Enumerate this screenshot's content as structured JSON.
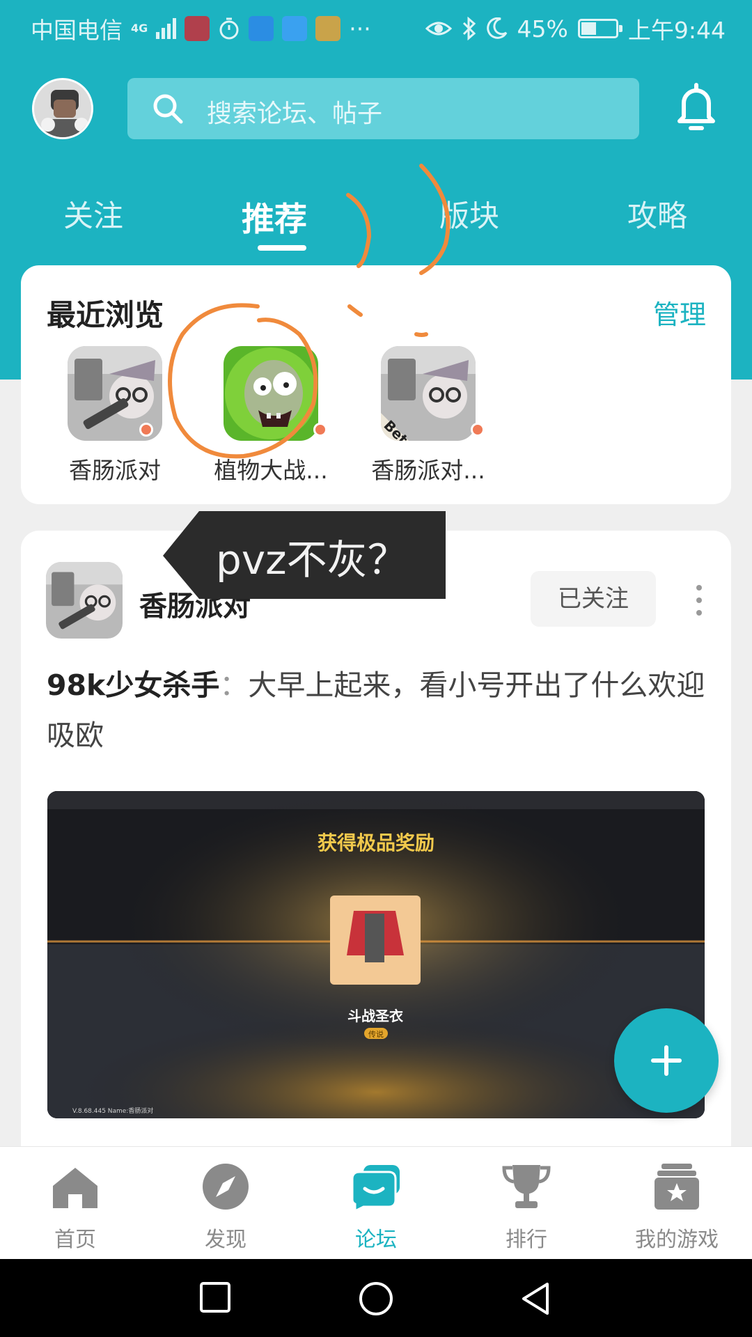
{
  "status_bar": {
    "carrier": "中国电信",
    "network": "4G",
    "battery_percent": "45%",
    "battery_level": 0.45,
    "time": "上午9:44",
    "more": "···",
    "colors": {
      "mic_app": "#b0404c",
      "bird_app": "#2b8de3",
      "baidu_app": "#3aa1f0",
      "play_app": "#c9a34a"
    }
  },
  "header": {
    "search_placeholder": "搜索论坛、帖子",
    "tabs": [
      {
        "label": "关注"
      },
      {
        "label": "推荐"
      },
      {
        "label": "版块"
      },
      {
        "label": "攻略"
      }
    ],
    "active_tab": "推荐"
  },
  "recent": {
    "title": "最近浏览",
    "manage": "管理",
    "games": [
      {
        "name": "香肠派对",
        "icon": "sausage-party-icon"
      },
      {
        "name": "植物大战...",
        "icon": "plants-vs-zombies-icon"
      },
      {
        "name": "香肠派对...",
        "icon": "sausage-party-beta-icon",
        "badge": "Beta"
      }
    ]
  },
  "annotation": {
    "tooltip": "pvz不灰？",
    "color": "#f08a3c"
  },
  "post": {
    "game_name": "香肠派对",
    "follow_label": "已关注",
    "author": "98k少女杀手",
    "separator": "：",
    "content": "大早上起来，看小号开出了什么欢迎吸欧",
    "image": {
      "title": "获得极品奖励",
      "item_name": "斗战圣衣",
      "rarity": "传说",
      "version": "V.8.68.445 Name:香肠派对"
    }
  },
  "bottom_nav": [
    {
      "label": "首页",
      "icon": "home-icon"
    },
    {
      "label": "发现",
      "icon": "compass-icon"
    },
    {
      "label": "论坛",
      "icon": "forum-icon"
    },
    {
      "label": "排行",
      "icon": "trophy-icon"
    },
    {
      "label": "我的游戏",
      "icon": "my-games-icon"
    }
  ],
  "active_nav": "论坛",
  "colors": {
    "accent": "#1cb3c1",
    "badge_dot": "#f07a56",
    "image_title": "#f2c94c"
  }
}
